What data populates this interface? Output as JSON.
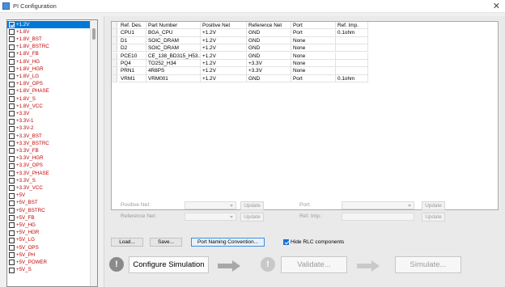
{
  "window": {
    "title": "PI Configuration",
    "close_glyph": "✕"
  },
  "nets": [
    {
      "label": "+1.2V",
      "checked": true,
      "selected": true
    },
    {
      "label": "+1.8V"
    },
    {
      "label": "+1.8V_BST"
    },
    {
      "label": "+1.8V_BSTRC"
    },
    {
      "label": "+1.8V_FB"
    },
    {
      "label": "+1.8V_HG"
    },
    {
      "label": "+1.8V_HGR"
    },
    {
      "label": "+1.8V_LG"
    },
    {
      "label": "+1.8V_OPS"
    },
    {
      "label": "+1.8V_PHASE"
    },
    {
      "label": "+1.8V_S"
    },
    {
      "label": "+1.8V_VCC"
    },
    {
      "label": "+3.3V"
    },
    {
      "label": "+3.3V-1"
    },
    {
      "label": "+3.3V-2"
    },
    {
      "label": "+3.3V_BST"
    },
    {
      "label": "+3.3V_BSTRC"
    },
    {
      "label": "+3.3V_FB"
    },
    {
      "label": "+3.3V_HGR"
    },
    {
      "label": "+3.3V_OPS"
    },
    {
      "label": "+3.3V_PHASE"
    },
    {
      "label": "+3.3V_S"
    },
    {
      "label": "+3.3V_VCC"
    },
    {
      "label": "+5V"
    },
    {
      "label": "+5V_BST"
    },
    {
      "label": "+5V_BSTRC"
    },
    {
      "label": "+5V_FB"
    },
    {
      "label": "+5V_HG"
    },
    {
      "label": "+5V_HGR"
    },
    {
      "label": "+5V_LG"
    },
    {
      "label": "+5V_OPS"
    },
    {
      "label": "+5V_PH"
    },
    {
      "label": "+5V_POWER"
    },
    {
      "label": "+5V_S"
    }
  ],
  "table": {
    "columns": [
      "Ref. Des.",
      "Part Number",
      "Positive Net",
      "Reference Net",
      "Port",
      "Ref. Imp."
    ],
    "rows": [
      [
        "CPU1",
        "BGA_CPU",
        "+1.2V",
        "GND",
        "Port",
        "0.1ohm"
      ],
      [
        "D1",
        "SOIC_DRAM",
        "+1.2V",
        "GND",
        "None",
        ""
      ],
      [
        "D2",
        "SOIC_DRAM",
        "+1.2V",
        "GND",
        "None",
        ""
      ],
      [
        "PCE10",
        "CE_138_BD315_H53...",
        "+1.2V",
        "GND",
        "None",
        ""
      ],
      [
        "PQ4",
        "TO252_H34",
        "+1.2V",
        "+3.3V",
        "None",
        ""
      ],
      [
        "PRN1",
        "4R8PS",
        "+1.2V",
        "+3.3V",
        "None",
        ""
      ],
      [
        "VRM1",
        "VRM001",
        "+1.2V",
        "GND",
        "Port",
        "0.1ohm"
      ]
    ]
  },
  "form": {
    "positive_net_label": "Positive Net:",
    "reference_net_label": "Reference Net:",
    "port_label": "Port:",
    "ref_imp_label": "Ref. Imp.:",
    "update_label": "Update"
  },
  "buttons": {
    "load": "Load...",
    "save": "Save...",
    "port_naming": "Port Naming Convention...",
    "hide_rlc": "Hide RLC components"
  },
  "workflow": {
    "configure": "Configure Simulation",
    "validate": "Validate...",
    "simulate": "Simulate...",
    "info_glyph": "!"
  },
  "colors": {
    "accent": "#0078d7",
    "net_text": "#c00000",
    "disabled_text": "#9b9b9b"
  }
}
